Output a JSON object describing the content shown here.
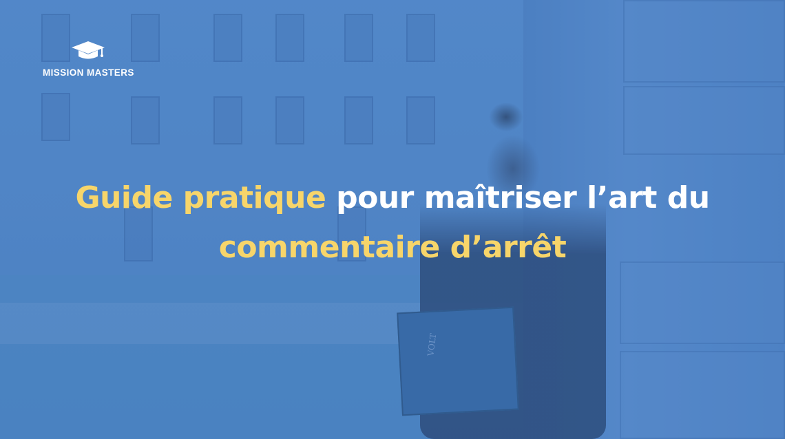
{
  "brand": {
    "name": "MISSION MASTERS",
    "icon": "graduation-cap-icon"
  },
  "headline": {
    "part1_highlight": "Guide pratique",
    "part2": "pour maîtriser l’art du",
    "part3_highlight": "commentaire d’arrêt"
  },
  "colors": {
    "overlay": "#4a82c8",
    "highlight": "#f7d56a",
    "text": "#ffffff"
  },
  "book_spine": "VOLT"
}
